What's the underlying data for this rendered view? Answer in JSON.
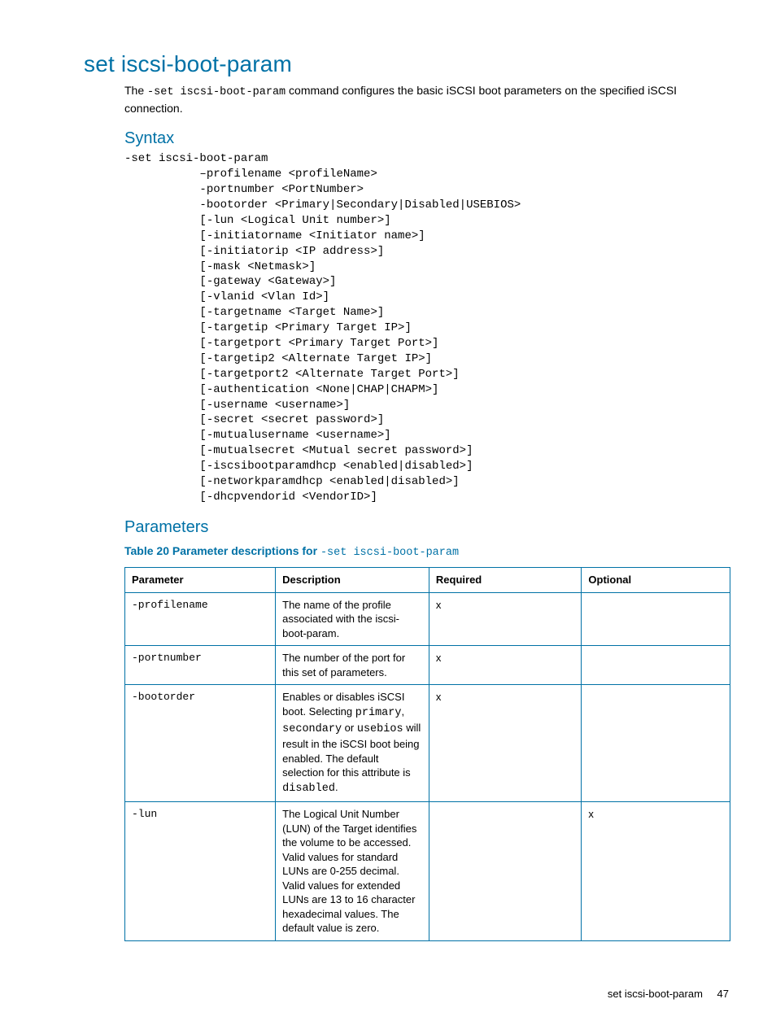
{
  "title": "set iscsi-boot-param",
  "intro_pre": "The ",
  "intro_code": "-set iscsi-boot-param",
  "intro_post": " command configures the basic iSCSI boot parameters on the specified iSCSI connection.",
  "syntax_heading": "Syntax",
  "syntax_block": "-set iscsi-boot-param\n           –profilename <profileName>\n           -portnumber <PortNumber>\n           -bootorder <Primary|Secondary|Disabled|USEBIOS>\n           [-lun <Logical Unit number>]\n           [-initiatorname <Initiator name>]\n           [-initiatorip <IP address>]\n           [-mask <Netmask>]\n           [-gateway <Gateway>]\n           [-vlanid <Vlan Id>]\n           [-targetname <Target Name>]\n           [-targetip <Primary Target IP>]\n           [-targetport <Primary Target Port>]\n           [-targetip2 <Alternate Target IP>]\n           [-targetport2 <Alternate Target Port>]\n           [-authentication <None|CHAP|CHAPM>]\n           [-username <username>]\n           [-secret <secret password>]\n           [-mutualusername <username>]\n           [-mutualsecret <Mutual secret password>]\n           [-iscsibootparamdhcp <enabled|disabled>]\n           [-networkparamdhcp <enabled|disabled>]\n           [-dhcpvendorid <VendorID>]",
  "params_heading": "Parameters",
  "table_caption_pre": "Table 20 Parameter descriptions for ",
  "table_caption_code": "-set iscsi-boot-param",
  "table": {
    "headers": {
      "c1": "Parameter",
      "c2": "Description",
      "c3": "Required",
      "c4": "Optional"
    },
    "rows": [
      {
        "param": "-profilename",
        "desc_html": "The name of the profile associated with the iscsi-boot-param.",
        "required": "x",
        "optional": ""
      },
      {
        "param": "-portnumber",
        "desc_html": "The number of the port for this set of parameters.",
        "required": "x",
        "optional": ""
      },
      {
        "param": "-bootorder",
        "desc_html": "Enables or disables iSCSI boot. Selecting <span class=\"mono\">primary</span>, <span class=\"mono\">secondary</span> or <span class=\"mono\">usebios</span> will result in the iSCSI boot being enabled. The default selection for this attribute is <span class=\"mono\">disabled</span>.",
        "required": "x",
        "optional": ""
      },
      {
        "param": "-lun",
        "desc_html": "The Logical Unit Number (LUN) of the Target identifies the volume to be accessed. Valid values for standard LUNs are 0-255 decimal. Valid values for extended LUNs are 13 to 16 character hexadecimal values. The default value is zero.",
        "required": "",
        "optional": "x"
      }
    ]
  },
  "footer": {
    "section": "set iscsi-boot-param",
    "page": "47"
  }
}
